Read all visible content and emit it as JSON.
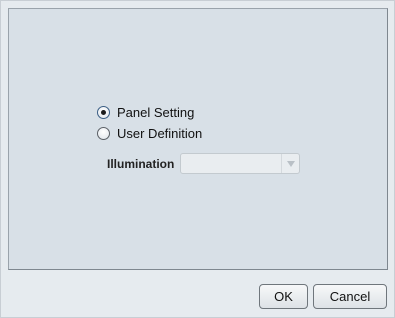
{
  "options": {
    "panel_setting": {
      "label": "Panel Setting",
      "checked": true
    },
    "user_definition": {
      "label": "User Definition",
      "checked": false
    }
  },
  "illumination": {
    "label": "Illumination",
    "value": "",
    "disabled": true
  },
  "buttons": {
    "ok_label": "OK",
    "cancel_label": "Cancel"
  },
  "icons": {
    "dropdown": "chevron-down-icon"
  }
}
